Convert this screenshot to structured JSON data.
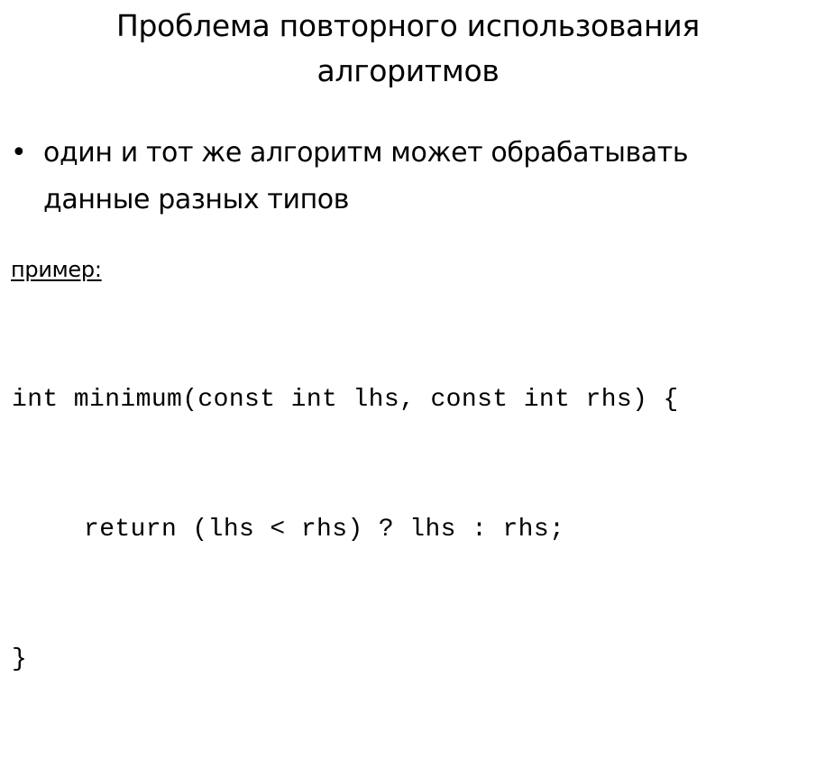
{
  "slide": {
    "title_lines": [
      "Проблема повторного использования",
      "алгоритмов"
    ],
    "bullet": {
      "mark": "•",
      "lines": [
        "один и тот же алгоритм может обрабатывать",
        "данные разных типов"
      ]
    },
    "example_label": "пример:",
    "code_lines": [
      "int minimum(const int lhs, const int rhs) {",
      "return (lhs < rhs) ? lhs : rhs;",
      "}"
    ]
  }
}
